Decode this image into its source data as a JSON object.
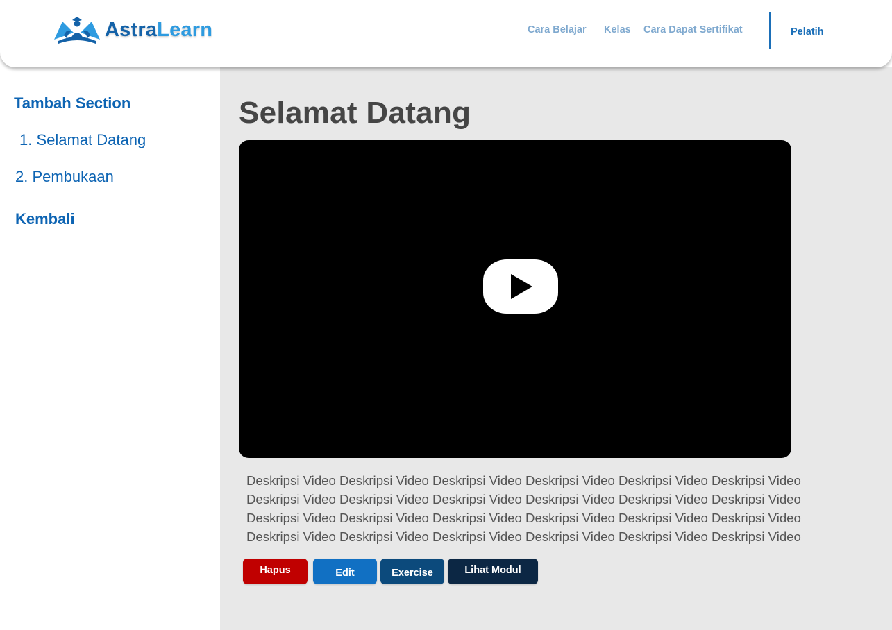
{
  "brand": {
    "name_part1": "Astra",
    "name_part2": "Learn",
    "logo_icon": "astralearn-logo-icon"
  },
  "nav": {
    "items": [
      {
        "label": "Cara Belajar"
      },
      {
        "label": "Kelas"
      },
      {
        "label": "Cara Dapat Sertifikat"
      }
    ],
    "account_label": "Pelatih"
  },
  "sidebar": {
    "add_section_label": "Tambah Section",
    "items": [
      {
        "label": "1. Selamat Datang"
      },
      {
        "label": "2. Pembukaan"
      }
    ],
    "back_label": "Kembali"
  },
  "main": {
    "title": "Selamat Datang",
    "video": {
      "play_icon": "play-icon"
    },
    "description": "Deskripsi Video Deskripsi Video Deskripsi Video Deskripsi Video Deskripsi Video Deskripsi Video Deskripsi Video Deskripsi Video Deskripsi Video Deskripsi Video Deskripsi Video Deskripsi Video Deskripsi Video Deskripsi Video Deskripsi Video Deskripsi Video Deskripsi Video Deskripsi Video Deskripsi Video Deskripsi Video Deskripsi Video Deskripsi Video Deskripsi Video Deskripsi Video",
    "buttons": {
      "delete": "Hapus",
      "edit": "Edit",
      "exercise": "Exercise",
      "view_module": "Lihat Modul"
    }
  },
  "colors": {
    "primary": "#0d64b3",
    "nav_muted": "#7fa9cf",
    "danger": "#c00000",
    "edit": "#1170c3",
    "exercise": "#0c4a7c",
    "module": "#0c2744",
    "main_bg": "#e8e8e8"
  }
}
